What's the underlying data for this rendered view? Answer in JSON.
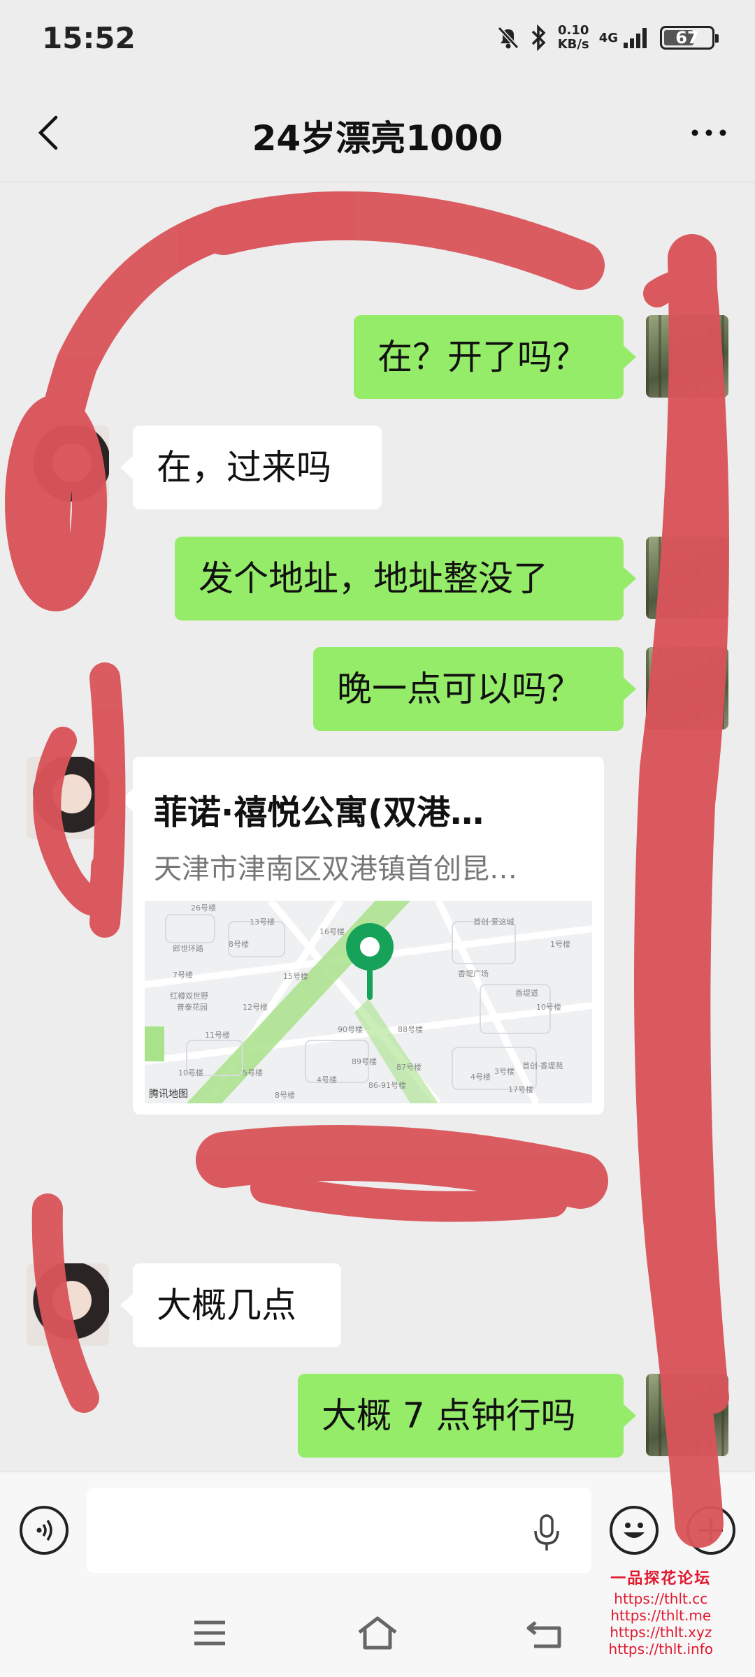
{
  "status_bar": {
    "time": "15:52",
    "speed_value": "0.10",
    "speed_unit": "KB/s",
    "network": "4G",
    "battery": "67",
    "battery_level": 0.67,
    "icons": [
      "mute-icon",
      "bluetooth-icon",
      "signal-icon",
      "battery-icon"
    ]
  },
  "header": {
    "title": "24岁漂亮1000",
    "back_icon": "chevron-left-icon",
    "more_icon": "more-icon"
  },
  "messages": [
    {
      "side": "me",
      "text": "在？开了吗？"
    },
    {
      "side": "her",
      "text": "在，过来吗"
    },
    {
      "side": "me",
      "text": "发个地址，地址整没了"
    },
    {
      "side": "me",
      "text": "晚一点可以吗？"
    },
    {
      "side": "her",
      "type": "location",
      "name": "菲诺·禧悦公寓(双港…",
      "address": "天津市津南区双港镇首创昆…"
    },
    {
      "side": "her",
      "text": "大概几点"
    },
    {
      "side": "me",
      "text": "大概 7 点钟行吗"
    }
  ],
  "map": {
    "credit": "腾讯地图",
    "labels": [
      "26号楼",
      "13号楼",
      "16号楼",
      "首创·爱这城",
      "1号楼",
      "郎世环路",
      "8号楼",
      "7号楼",
      "15号楼",
      "香堤广场",
      "香堤道",
      "红樽双世野",
      "普泰花园",
      "12号楼",
      "10号楼",
      "11号楼",
      "90号楼",
      "88号楼",
      "首创·香堤苑",
      "89号楼",
      "87号楼",
      "4号楼",
      "3号楼",
      "10号楼",
      "5号楼",
      "4号楼",
      "86-91号楼",
      "17号楼",
      "8号楼"
    ]
  },
  "input_bar": {
    "voice_icon": "voice-icon",
    "mic_icon": "mic-icon",
    "emoji_icon": "emoji-icon",
    "plus_icon": "plus-icon"
  },
  "nav_bar": {
    "icons": [
      "menu-icon",
      "home-icon",
      "back-icon"
    ]
  },
  "watermark": {
    "title": "一品探花论坛",
    "urls": [
      "https://thlt.cc",
      "https://thlt.me",
      "https://thlt.xyz",
      "https://thlt.info"
    ]
  },
  "colors": {
    "me_bubble": "#95ec69",
    "her_bubble": "#ffffff",
    "background": "#ededed",
    "scribble": "#d9545a",
    "pin": "#17a25a",
    "watermark": "#e0182d"
  }
}
